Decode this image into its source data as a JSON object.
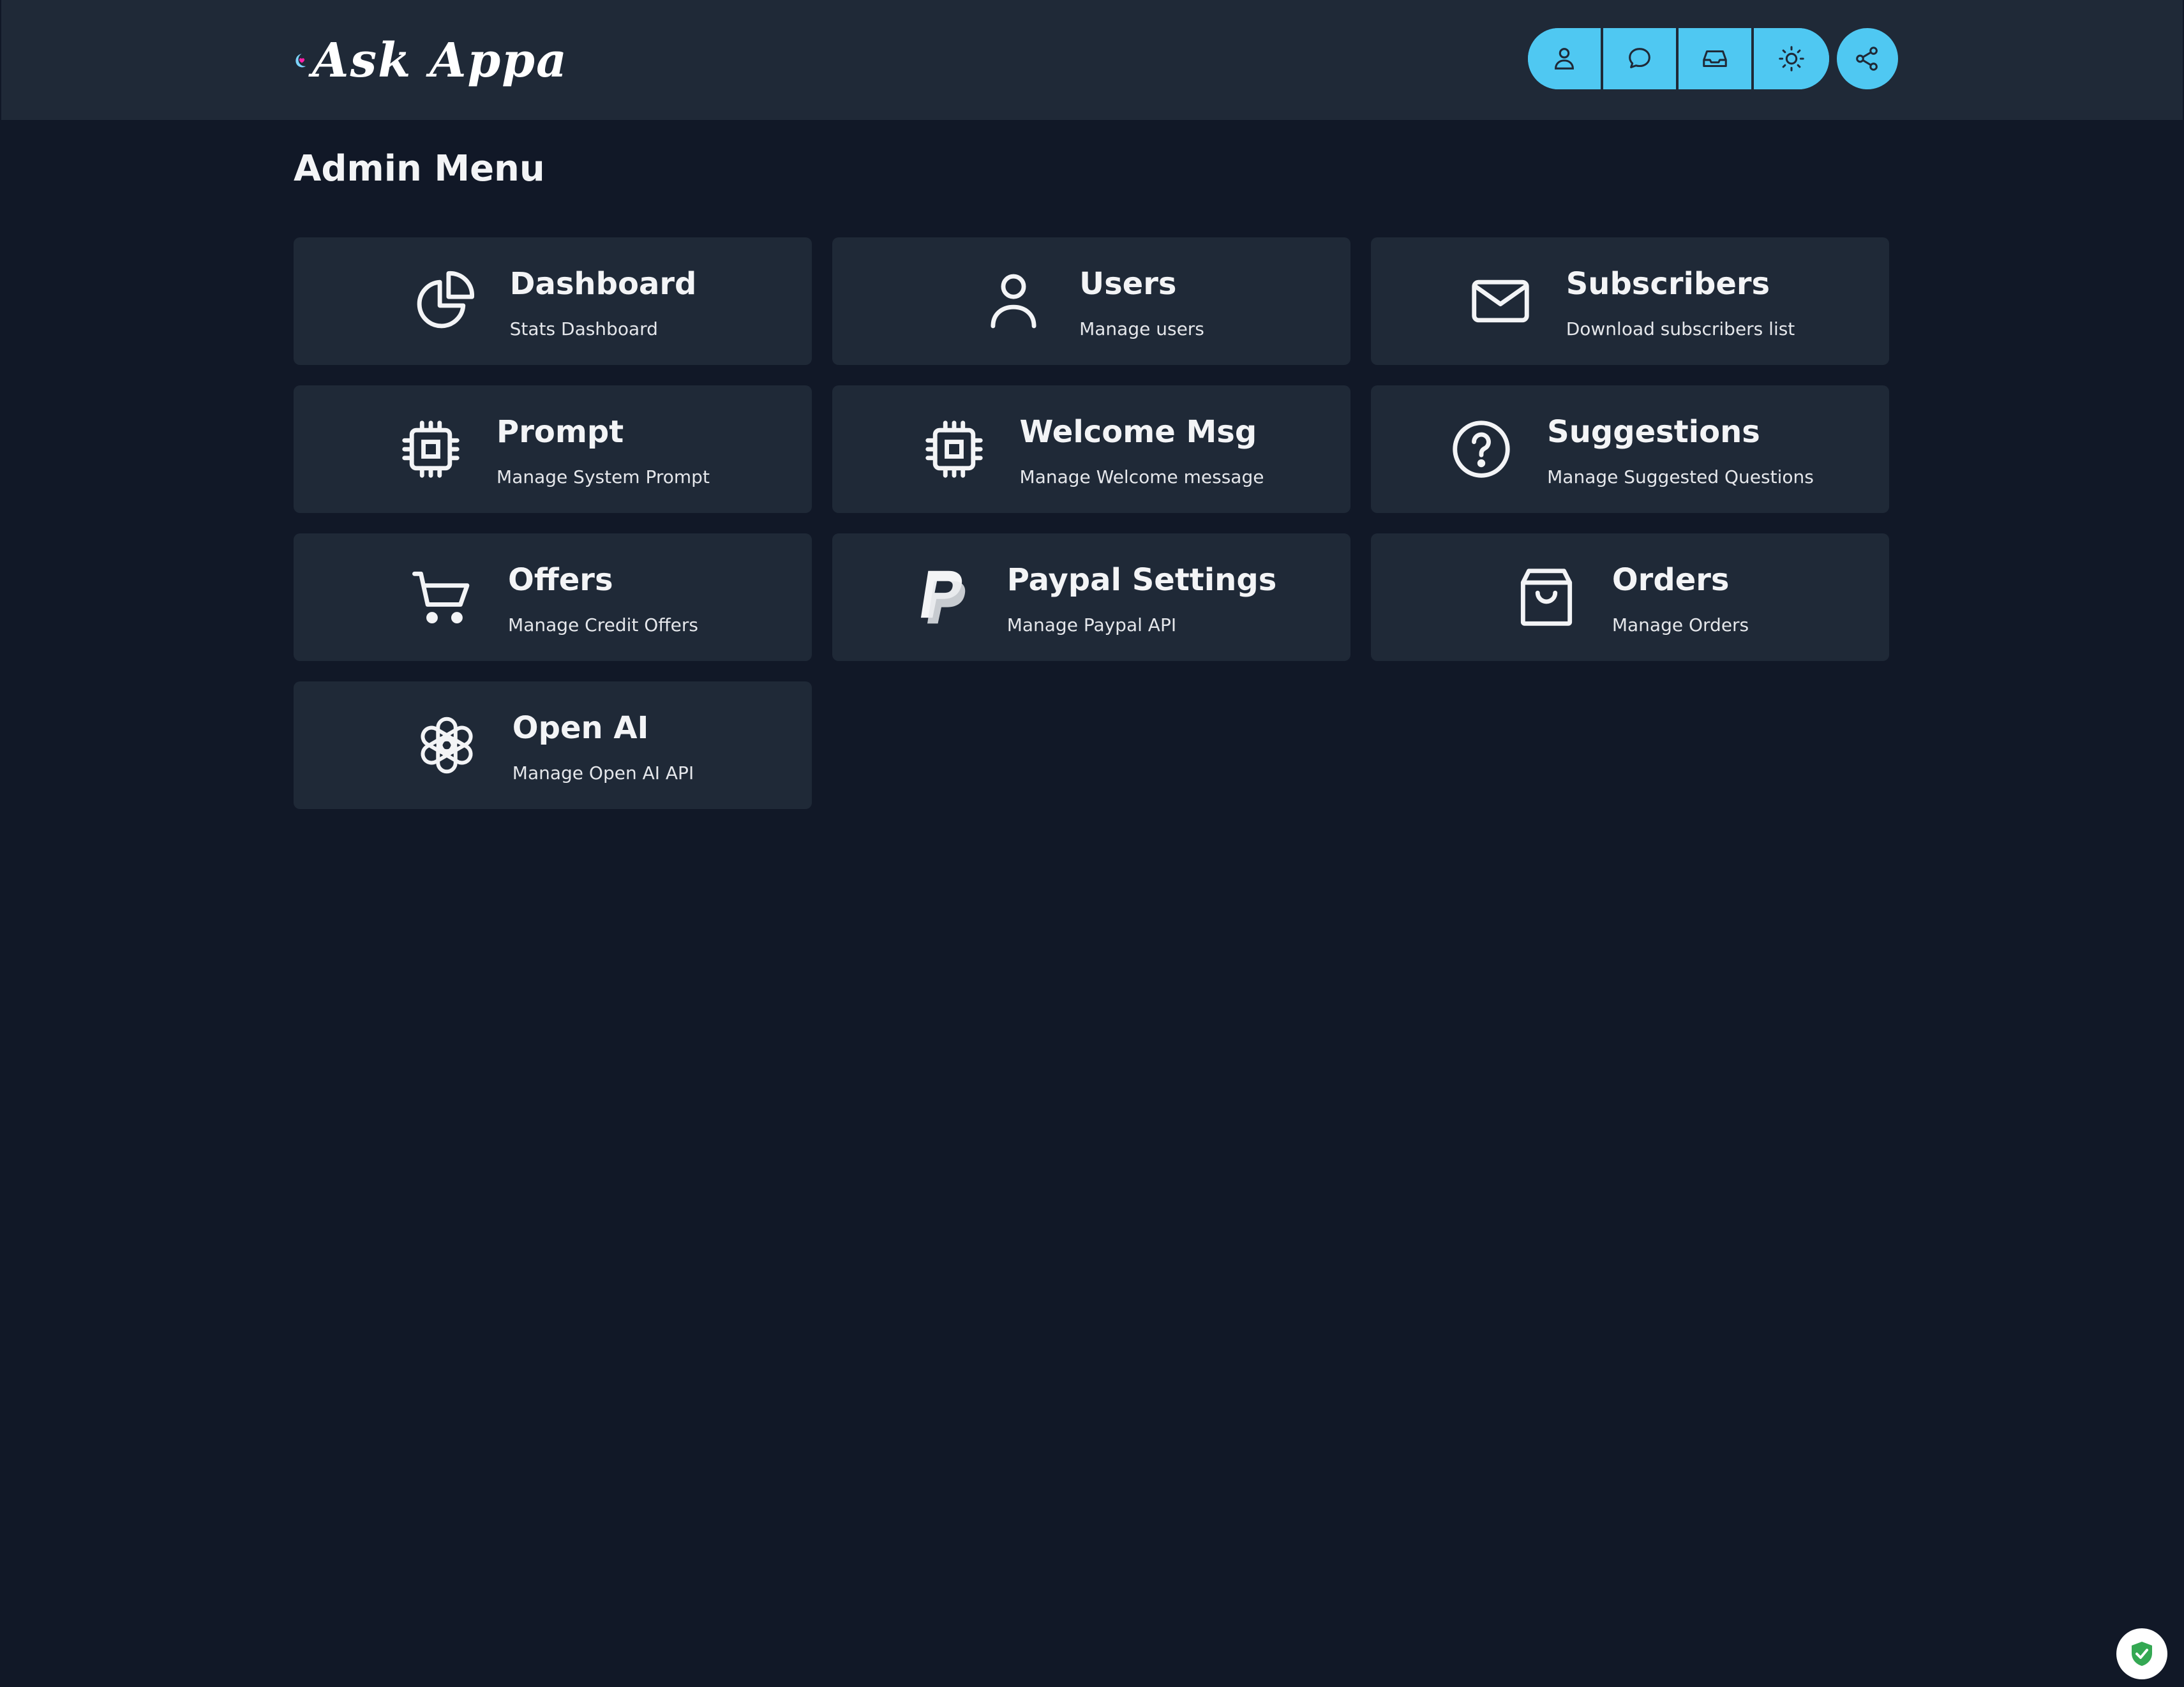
{
  "header": {
    "logo_text": "Ask Appa",
    "buttons": [
      {
        "icon": "user-icon"
      },
      {
        "icon": "chat-bubble-icon"
      },
      {
        "icon": "inbox-icon"
      },
      {
        "icon": "sun-icon"
      }
    ],
    "share_icon": "share-icon"
  },
  "page": {
    "title": "Admin Menu"
  },
  "cards": [
    {
      "icon": "pie-chart-icon",
      "title": "Dashboard",
      "description": "Stats Dashboard"
    },
    {
      "icon": "user-icon",
      "title": "Users",
      "description": "Manage users"
    },
    {
      "icon": "envelope-icon",
      "title": "Subscribers",
      "description": "Download subscribers list"
    },
    {
      "icon": "cpu-chip-icon",
      "title": "Prompt",
      "description": "Manage System Prompt"
    },
    {
      "icon": "cpu-chip-icon",
      "title": "Welcome Msg",
      "description": "Manage Welcome message"
    },
    {
      "icon": "question-circle-icon",
      "title": "Suggestions",
      "description": "Manage Suggested Questions"
    },
    {
      "icon": "shopping-cart-icon",
      "title": "Offers",
      "description": "Manage Credit Offers"
    },
    {
      "icon": "paypal-icon",
      "title": "Paypal Settings",
      "description": "Manage Paypal API"
    },
    {
      "icon": "shopping-bag-icon",
      "title": "Orders",
      "description": "Manage Orders"
    },
    {
      "icon": "openai-icon",
      "title": "Open AI",
      "description": "Manage Open AI API"
    }
  ],
  "colors": {
    "background": "#111827",
    "header": "#1f2937",
    "card": "#1f2937",
    "accent": "#4fc8f2",
    "logo_heart": "#ff1fa8",
    "logo_moon": "#7dd3fc"
  }
}
